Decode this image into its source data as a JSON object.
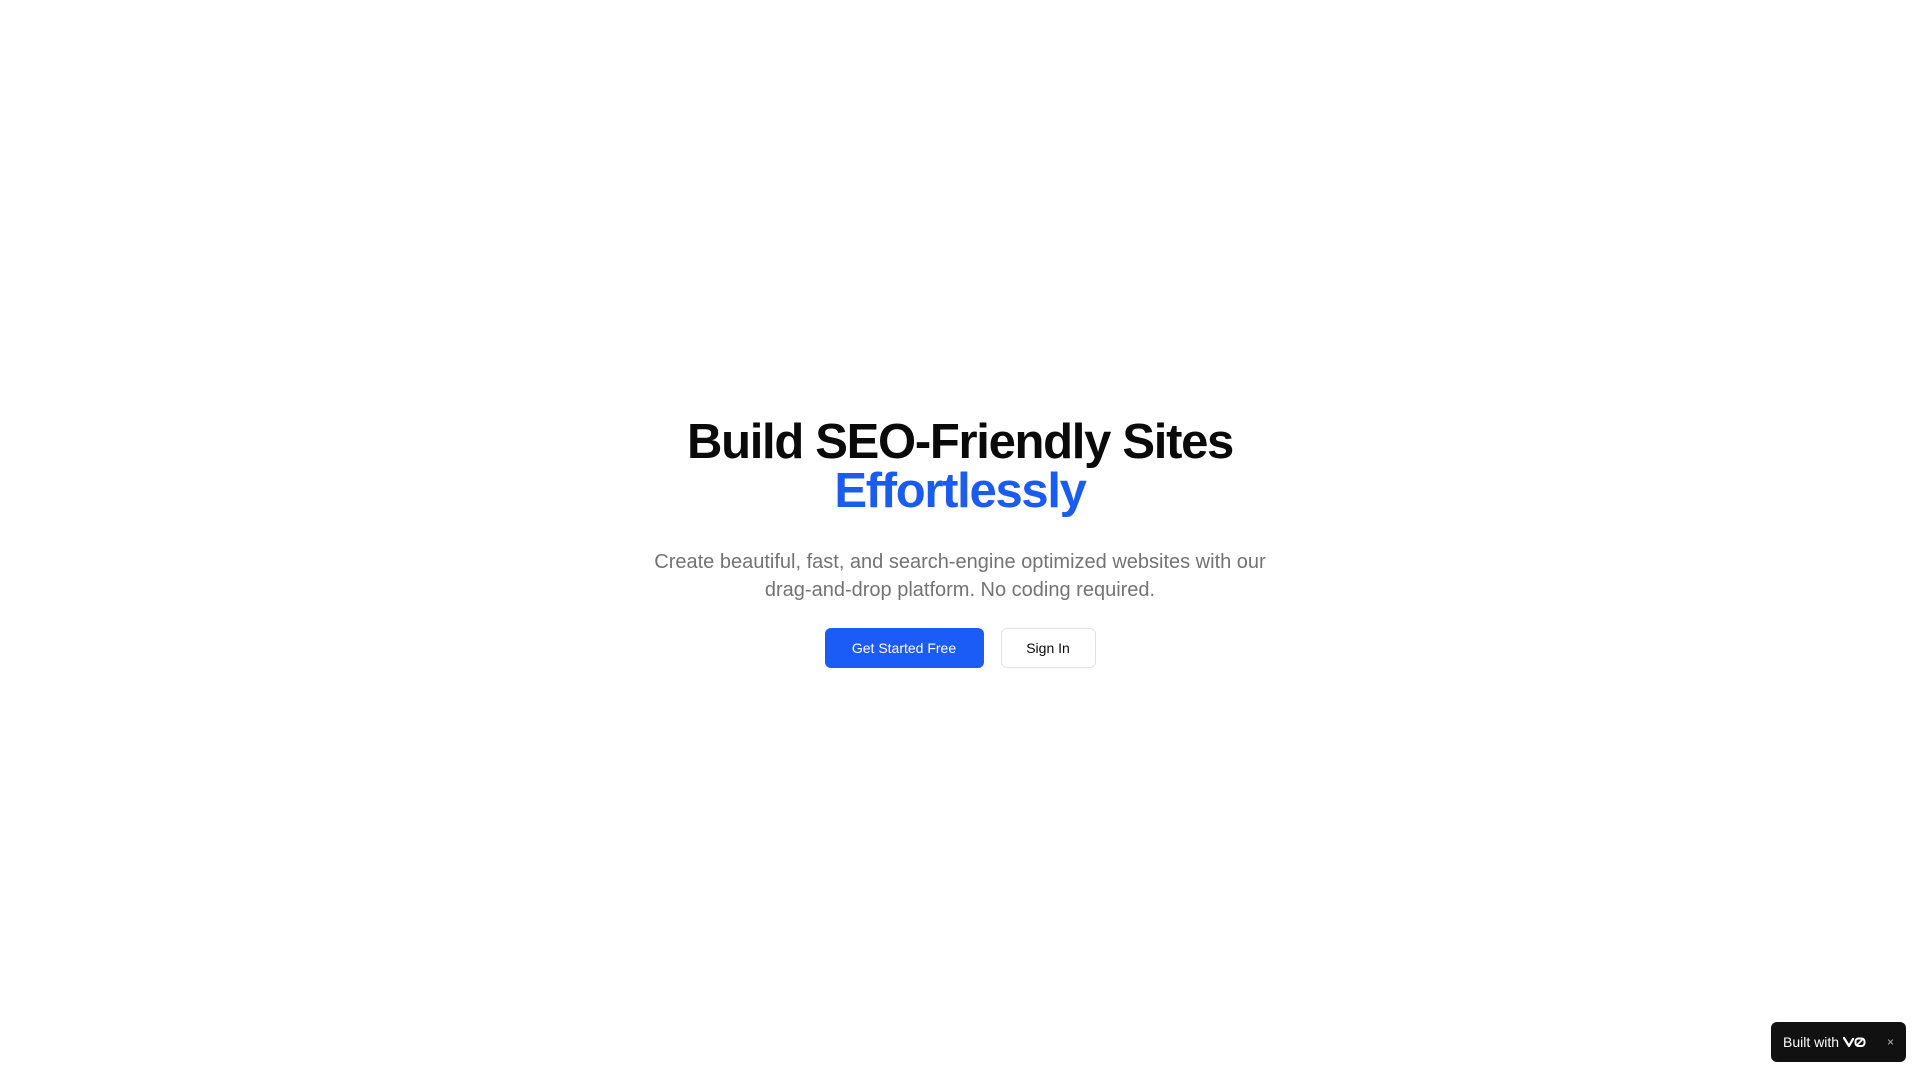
{
  "hero": {
    "headline_line1": "Build SEO-Friendly Sites",
    "headline_accent": "Effortlessly",
    "subtitle": "Create beautiful, fast, and search-engine optimized websites with our drag-and-drop platform. No coding required.",
    "primary_cta_label": "Get Started Free",
    "secondary_cta_label": "Sign In"
  },
  "badge": {
    "text": "Built with",
    "logo_icon": "v0-logo-icon",
    "close_icon": "×"
  },
  "colors": {
    "accent": "#1a5cf0",
    "headline": "#0a0a0a",
    "subtitle": "#737373",
    "badge_bg": "#111111"
  }
}
